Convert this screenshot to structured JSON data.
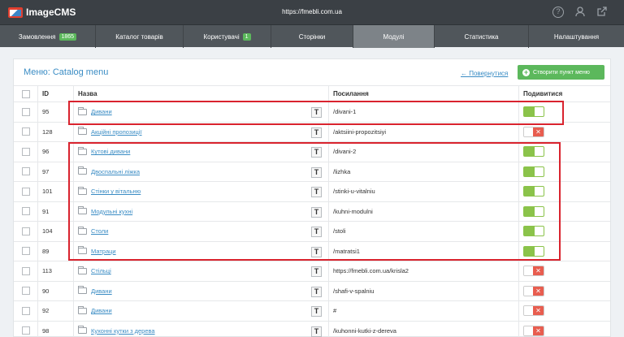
{
  "topbar": {
    "brand": "ImageCMS",
    "url": "https://fmebli.com.ua",
    "icons": [
      "help-icon",
      "user-icon",
      "external-link-icon"
    ]
  },
  "nav": [
    {
      "label": "Замовлення",
      "badge": "1865",
      "active": false
    },
    {
      "label": "Каталог товарів",
      "badge": "",
      "active": false
    },
    {
      "label": "Користувачі",
      "badge": "1",
      "active": false
    },
    {
      "label": "Сторінки",
      "badge": "",
      "active": false
    },
    {
      "label": "Модулі",
      "badge": "",
      "active": true
    },
    {
      "label": "Статистика",
      "badge": "",
      "active": false
    },
    {
      "label": "Налаштування",
      "badge": "",
      "active": false
    }
  ],
  "panel": {
    "title": "Меню: Catalog menu",
    "back_link": "← Повернутися",
    "create_button": "Створити пункт меню"
  },
  "table": {
    "headers": {
      "id": "ID",
      "name": "Назва",
      "link": "Посилання",
      "show": "Подивитися"
    },
    "rows": [
      {
        "id": "95",
        "name": "Дивани",
        "link": "/divani-1",
        "visible": true
      },
      {
        "id": "128",
        "name": "Акційні пропозиції",
        "link": "/aktsiini-propozitsiyi",
        "visible": false
      },
      {
        "id": "96",
        "name": "Кутові дивани",
        "link": "/divani-2",
        "visible": true
      },
      {
        "id": "97",
        "name": "Двоспальні ліжка",
        "link": "/lizhka",
        "visible": true
      },
      {
        "id": "101",
        "name": "Стінки у вітальню",
        "link": "/stinki-u-vitalniu",
        "visible": true
      },
      {
        "id": "91",
        "name": "Модульні кухні",
        "link": "/kuhni-modulni",
        "visible": true
      },
      {
        "id": "104",
        "name": "Столи",
        "link": "/stoli",
        "visible": true
      },
      {
        "id": "89",
        "name": "Матраци",
        "link": "/matratsi1",
        "visible": true
      },
      {
        "id": "113",
        "name": "Стільці",
        "link": "https://fmebli.com.ua/krisla2",
        "visible": false
      },
      {
        "id": "90",
        "name": "Дивани",
        "link": "/shafi-v-spalniu",
        "visible": false
      },
      {
        "id": "92",
        "name": "Дивани",
        "link": "#",
        "visible": false
      },
      {
        "id": "98",
        "name": "Кухонні кутки з дерева",
        "link": "/kuhonni-kutki-z-dereva",
        "visible": false
      }
    ]
  },
  "colors": {
    "accent": "#3a8cc4",
    "toggle_on": "#8bc34a",
    "toggle_off_x": "#e85d4f",
    "highlight": "#d9232e",
    "create_button": "#5cb85c"
  }
}
